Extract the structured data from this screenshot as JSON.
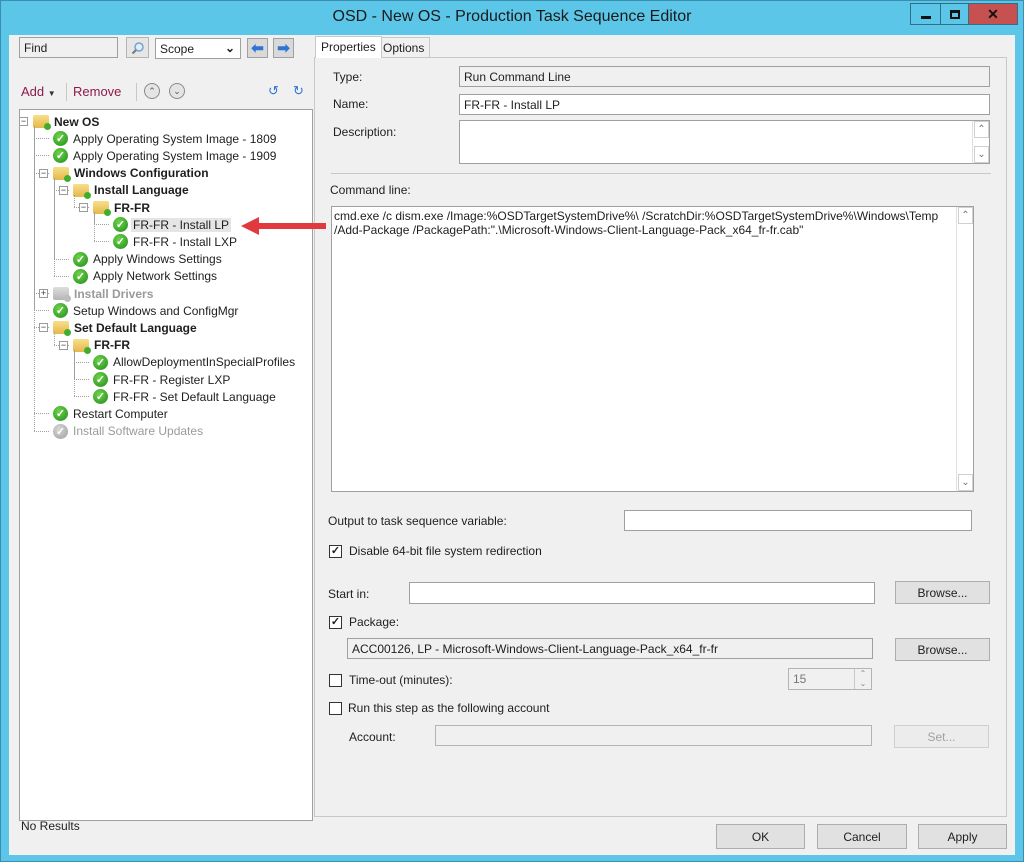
{
  "window": {
    "title": "OSD - New OS - Production Task Sequence Editor",
    "controls": [
      "minimize",
      "maximize",
      "close"
    ]
  },
  "search": {
    "find_placeholder": "Find",
    "scope_value": "Scope",
    "back_icon": "arrow-left-icon",
    "forward_icon": "arrow-right-icon"
  },
  "toolbar": {
    "add_label": "Add",
    "remove_label": "Remove",
    "move_up_icon": "move-up-icon",
    "move_down_icon": "move-down-icon"
  },
  "tree": {
    "items": [
      {
        "label": "New OS",
        "level": 0,
        "type": "group",
        "bold": true,
        "expanded": true
      },
      {
        "label": "Apply Operating System Image - 1809",
        "level": 1,
        "type": "step"
      },
      {
        "label": "Apply Operating System Image - 1909",
        "level": 1,
        "type": "step"
      },
      {
        "label": "Windows Configuration",
        "level": 1,
        "type": "group",
        "bold": true,
        "expanded": true
      },
      {
        "label": "Install Language",
        "level": 2,
        "type": "group",
        "bold": true,
        "expanded": true
      },
      {
        "label": "FR-FR",
        "level": 3,
        "type": "group",
        "bold": true,
        "expanded": true
      },
      {
        "label": "FR-FR - Install LP",
        "level": 4,
        "type": "step",
        "selected": true
      },
      {
        "label": "FR-FR - Install LXP",
        "level": 4,
        "type": "step"
      },
      {
        "label": "Apply Windows Settings",
        "level": 2,
        "type": "step"
      },
      {
        "label": "Apply Network Settings",
        "level": 2,
        "type": "step"
      },
      {
        "label": "Install Drivers",
        "level": 1,
        "type": "group",
        "bold": true,
        "disabled": true,
        "expanded": false
      },
      {
        "label": "Setup Windows and ConfigMgr",
        "level": 1,
        "type": "step"
      },
      {
        "label": "Set Default Language",
        "level": 1,
        "type": "group",
        "bold": true,
        "expanded": true
      },
      {
        "label": "FR-FR",
        "level": 2,
        "type": "group",
        "bold": true,
        "expanded": true
      },
      {
        "label": "AllowDeploymentInSpecialProfiles",
        "level": 3,
        "type": "step"
      },
      {
        "label": "FR-FR - Register LXP",
        "level": 3,
        "type": "step"
      },
      {
        "label": "FR-FR - Set Default Language",
        "level": 3,
        "type": "step"
      },
      {
        "label": "Restart Computer",
        "level": 1,
        "type": "step"
      },
      {
        "label": "Install Software Updates",
        "level": 1,
        "type": "step",
        "disabled": true
      }
    ],
    "status": "No Results"
  },
  "tabs": [
    {
      "label": "Properties",
      "active": true
    },
    {
      "label": "Options",
      "active": false
    }
  ],
  "properties": {
    "type_label": "Type:",
    "type_value": "Run Command Line",
    "name_label": "Name:",
    "name_value": "FR-FR - Install LP",
    "description_label": "Description:",
    "description_value": "",
    "command_line_label": "Command line:",
    "command_line_value": "cmd.exe /c dism.exe /Image:%OSDTargetSystemDrive%\\ /ScratchDir:%OSDTargetSystemDrive%\\Windows\\Temp\n/Add-Package /PackagePath:\".\\Microsoft-Windows-Client-Language-Pack_x64_fr-fr.cab\"",
    "output_variable_label": "Output to task sequence variable:",
    "output_variable_value": "",
    "disable_redirection_label": "Disable 64-bit file system redirection",
    "disable_redirection_checked": true,
    "start_in_label": "Start in:",
    "start_in_value": "",
    "browse_label": "Browse...",
    "package_label": "Package:",
    "package_checked": true,
    "package_value": "ACC00126, LP - Microsoft-Windows-Client-Language-Pack_x64_fr-fr",
    "timeout_label": "Time-out (minutes):",
    "timeout_checked": false,
    "timeout_value": "15",
    "run_as_label": "Run this step as the following account",
    "run_as_checked": false,
    "account_label": "Account:",
    "account_value": "",
    "set_label": "Set..."
  },
  "footer": {
    "ok_label": "OK",
    "cancel_label": "Cancel",
    "apply_label": "Apply"
  },
  "annotation": {
    "arrow_color": "#e0393e"
  }
}
